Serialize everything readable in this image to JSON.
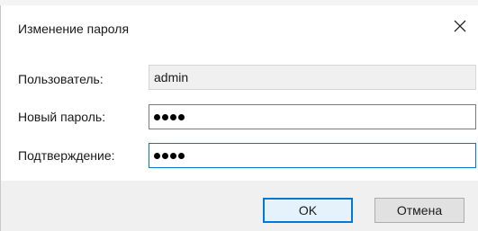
{
  "dialog": {
    "title": "Изменение пароля",
    "close_icon": "close-icon"
  },
  "form": {
    "user_label": "Пользователь:",
    "user_value": "admin",
    "new_password_label": "Новый пароль:",
    "new_password_masked_length": 4,
    "confirm_label": "Подтверждение:",
    "confirm_masked_length": 4
  },
  "buttons": {
    "ok": "OK",
    "cancel": "Отмена"
  },
  "colors": {
    "accent": "#0078d7",
    "readonly_bg": "#f0f0f0",
    "footer_bg": "#f0f0f0"
  }
}
